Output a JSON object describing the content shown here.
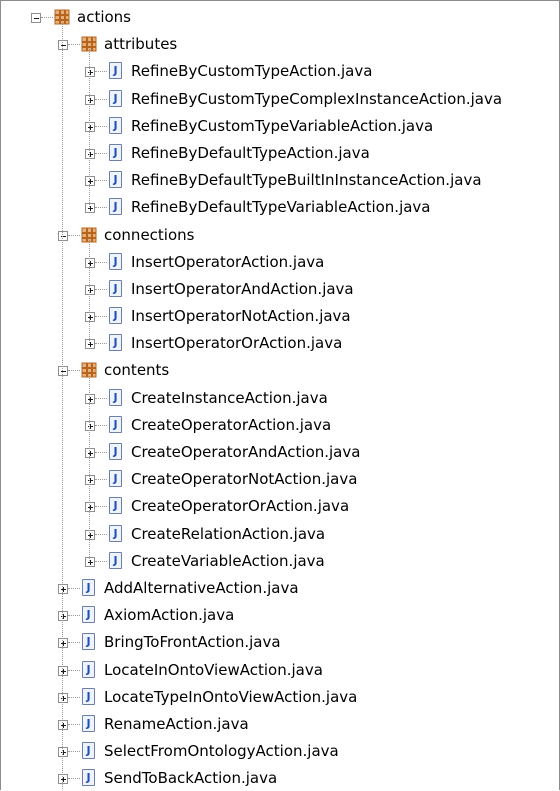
{
  "tree": {
    "root": {
      "label": "actions",
      "icon": "package-icon",
      "expanded": true
    },
    "packages": [
      {
        "label": "attributes",
        "icon": "package-icon",
        "expanded": true,
        "files": [
          "RefineByCustomTypeAction.java",
          "RefineByCustomTypeComplexInstanceAction.java",
          "RefineByCustomTypeVariableAction.java",
          "RefineByDefaultTypeAction.java",
          "RefineByDefaultTypeBuiltInInstanceAction.java",
          "RefineByDefaultTypeVariableAction.java"
        ]
      },
      {
        "label": "connections",
        "icon": "package-icon",
        "expanded": true,
        "files": [
          "InsertOperatorAction.java",
          "InsertOperatorAndAction.java",
          "InsertOperatorNotAction.java",
          "InsertOperatorOrAction.java"
        ]
      },
      {
        "label": "contents",
        "icon": "package-icon",
        "expanded": true,
        "files": [
          "CreateInstanceAction.java",
          "CreateOperatorAction.java",
          "CreateOperatorAndAction.java",
          "CreateOperatorNotAction.java",
          "CreateOperatorOrAction.java",
          "CreateRelationAction.java",
          "CreateVariableAction.java"
        ]
      }
    ],
    "root_files": [
      "AddAlternativeAction.java",
      "AxiomAction.java",
      "BringToFrontAction.java",
      "LocateInOntoViewAction.java",
      "LocateTypeInOntoViewAction.java",
      "RenameAction.java",
      "SelectFromOntologyAction.java",
      "SendToBackAction.java"
    ],
    "java_icon_glyph": "J",
    "colors": {
      "package_brown": "#b5651d",
      "package_light": "#e8b07a",
      "java_blue": "#1f4fb3",
      "dotted_line": "#9a9a9a",
      "border": "#8c8c8c"
    }
  }
}
